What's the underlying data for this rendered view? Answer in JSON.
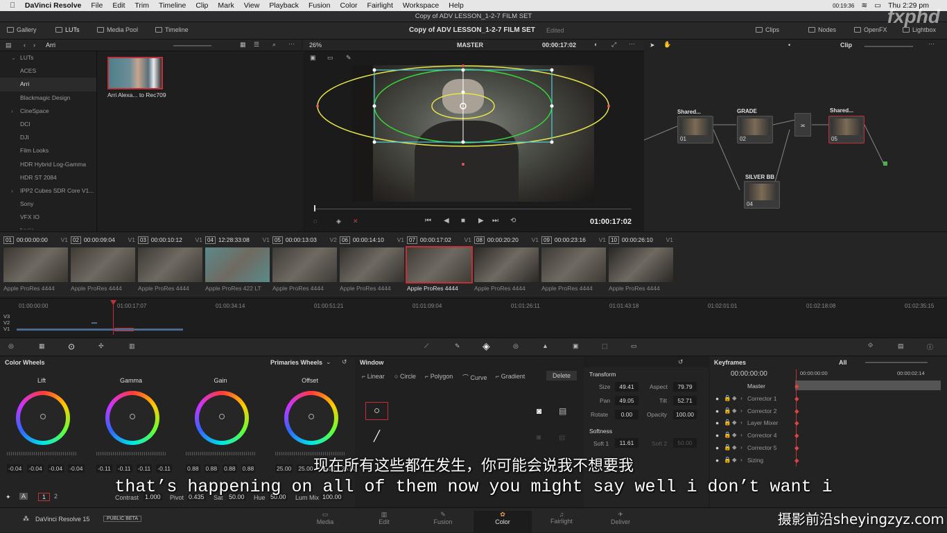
{
  "menubar": {
    "app": "DaVinci Resolve",
    "items": [
      "File",
      "Edit",
      "Trim",
      "Timeline",
      "Clip",
      "Mark",
      "View",
      "Playback",
      "Fusion",
      "Color",
      "Fairlight",
      "Workspace",
      "Help"
    ],
    "clock": "Thu 2:29 pm",
    "status_time": "00:19:36"
  },
  "window_title": "Copy of ADV LESSON_1-2-7 FILM SET",
  "toolbar": {
    "gallery": "Gallery",
    "luts": "LUTs",
    "media_pool": "Media Pool",
    "timeline": "Timeline",
    "project": "Copy of ADV LESSON_1-2-7 FILM SET",
    "edited": "Edited",
    "clips": "Clips",
    "nodes": "Nodes",
    "openfx": "OpenFX",
    "lightbox": "Lightbox"
  },
  "lut_panel": {
    "folder": "Arri",
    "items": [
      {
        "label": "LUTs",
        "chev": "⌄"
      },
      {
        "label": "ACES",
        "chev": ""
      },
      {
        "label": "Arri",
        "chev": ""
      },
      {
        "label": "Blackmagic Design",
        "chev": ""
      },
      {
        "label": "CineSpace",
        "chev": "›"
      },
      {
        "label": "DCI",
        "chev": ""
      },
      {
        "label": "DJI",
        "chev": ""
      },
      {
        "label": "Film Looks",
        "chev": ""
      },
      {
        "label": "HDR Hybrid Log-Gamma",
        "chev": ""
      },
      {
        "label": "HDR ST 2084",
        "chev": ""
      },
      {
        "label": "IPP2 Cubes SDR Core V1...",
        "chev": "›"
      },
      {
        "label": "Sony",
        "chev": ""
      },
      {
        "label": "VFX IO",
        "chev": ""
      },
      {
        "label": "basic",
        "chev": ""
      }
    ],
    "thumb_label": "Arri Alexa... to Rec709"
  },
  "viewer": {
    "zoom": "26%",
    "mode": "MASTER",
    "timecode": "00:00:17:02",
    "playhead": "01:00:17:02"
  },
  "nodes": {
    "mode": "Clip",
    "list": [
      {
        "label": "Shared...",
        "num": "01"
      },
      {
        "label": "GRADE",
        "num": "02"
      },
      {
        "label": "SILVER BB",
        "num": "04"
      },
      {
        "label": "Shared...",
        "num": "05"
      }
    ]
  },
  "clips": [
    {
      "n": "01",
      "tc": "00:00:00:00",
      "v": "V1",
      "codec": "Apple ProRes 4444"
    },
    {
      "n": "02",
      "tc": "00:00:09:04",
      "v": "V1",
      "codec": "Apple ProRes 4444"
    },
    {
      "n": "03",
      "tc": "00:00:10:12",
      "v": "V1",
      "codec": "Apple ProRes 4444"
    },
    {
      "n": "04",
      "tc": "12:28:33:08",
      "v": "V1",
      "codec": "Apple ProRes 422 LT"
    },
    {
      "n": "05",
      "tc": "00:00:13:03",
      "v": "V2",
      "codec": "Apple ProRes 4444"
    },
    {
      "n": "06",
      "tc": "00:00:14:10",
      "v": "V1",
      "codec": "Apple ProRes 4444"
    },
    {
      "n": "07",
      "tc": "00:00:17:02",
      "v": "V1",
      "codec": "Apple ProRes 4444"
    },
    {
      "n": "08",
      "tc": "00:00:20:20",
      "v": "V1",
      "codec": "Apple ProRes 4444"
    },
    {
      "n": "09",
      "tc": "00:00:23:16",
      "v": "V1",
      "codec": "Apple ProRes 4444"
    },
    {
      "n": "10",
      "tc": "00:00:26:10",
      "v": "V1",
      "codec": "Apple ProRes 4444"
    }
  ],
  "timeline": {
    "ticks": [
      "01:00:00:00",
      "01:00:17:07",
      "01:00:34:14",
      "01:00:51:21",
      "01:01:09:04",
      "01:01:26:11",
      "01:01:43:18",
      "01:02:01:01",
      "01:02:18:08",
      "01:02:35:15"
    ],
    "tracks": [
      "V3",
      "V2",
      "V1"
    ]
  },
  "color_wheels": {
    "title": "Color Wheels",
    "mode": "Primaries Wheels",
    "wheels": [
      {
        "name": "Lift",
        "vals": [
          "-0.04",
          "-0.04",
          "-0.04",
          "-0.04"
        ]
      },
      {
        "name": "Gamma",
        "vals": [
          "-0.11",
          "-0.11",
          "-0.11",
          "-0.11"
        ]
      },
      {
        "name": "Gain",
        "vals": [
          "0.88",
          "0.88",
          "0.88",
          "0.88"
        ]
      },
      {
        "name": "Offset",
        "vals": [
          "25.00",
          "25.00",
          "25.00",
          "25.00"
        ]
      }
    ],
    "bottom": {
      "contrast_label": "Contrast",
      "contrast": "1.000",
      "pivot_label": "Pivot",
      "pivot": "0.435",
      "sat_label": "Sat",
      "sat": "50.00",
      "hue_label": "Hue",
      "hue": "50.00",
      "lummix_label": "Lum Mix",
      "lummix": "100.00"
    },
    "page1": "1",
    "page2": "2"
  },
  "window_panel": {
    "title": "Window",
    "tools": [
      "Linear",
      "Circle",
      "Polygon",
      "Curve",
      "Gradient"
    ],
    "delete": "Delete"
  },
  "transform": {
    "title": "Transform",
    "size_label": "Size",
    "size": "49.41",
    "aspect_label": "Aspect",
    "aspect": "79.79",
    "pan_label": "Pan",
    "pan": "49.05",
    "tilt_label": "Tilt",
    "tilt": "52.71",
    "rotate_label": "Rotate",
    "rotate": "0.00",
    "opacity_label": "Opacity",
    "opacity": "100.00",
    "softness": "Softness",
    "soft1_label": "Soft 1",
    "soft1": "11.61",
    "soft2_label": "Soft 2",
    "soft2": "50.00"
  },
  "keyframes": {
    "title": "Keyframes",
    "filter": "All",
    "tc": "00:00:00:00",
    "tc2": "00:00:00:00",
    "tc3": "00:00:02:14",
    "rows": [
      "Master",
      "Corrector 1",
      "Corrector 2",
      "Layer Mixer",
      "Corrector 4",
      "Corrector 5",
      "Sizing"
    ]
  },
  "footer": {
    "brand": "DaVinci Resolve 15",
    "beta": "PUBLIC BETA",
    "pages": [
      "Media",
      "Edit",
      "Fusion",
      "Color",
      "Fairlight",
      "Deliver"
    ]
  },
  "subtitles": {
    "cn": "现在所有这些都在发生，你可能会说我不想要我",
    "en": "that’s happening on all of them now you might say well i don’t want i"
  },
  "watermark": {
    "cn": "摄影前沿",
    "url": "sheyingzyz.com",
    "logo": "fxphd"
  },
  "colors": {
    "accent_red": "#c3303a",
    "window_yellow": "#e6e64a",
    "window_green": "#39d639",
    "window_cyan": "#4fd0e0"
  }
}
